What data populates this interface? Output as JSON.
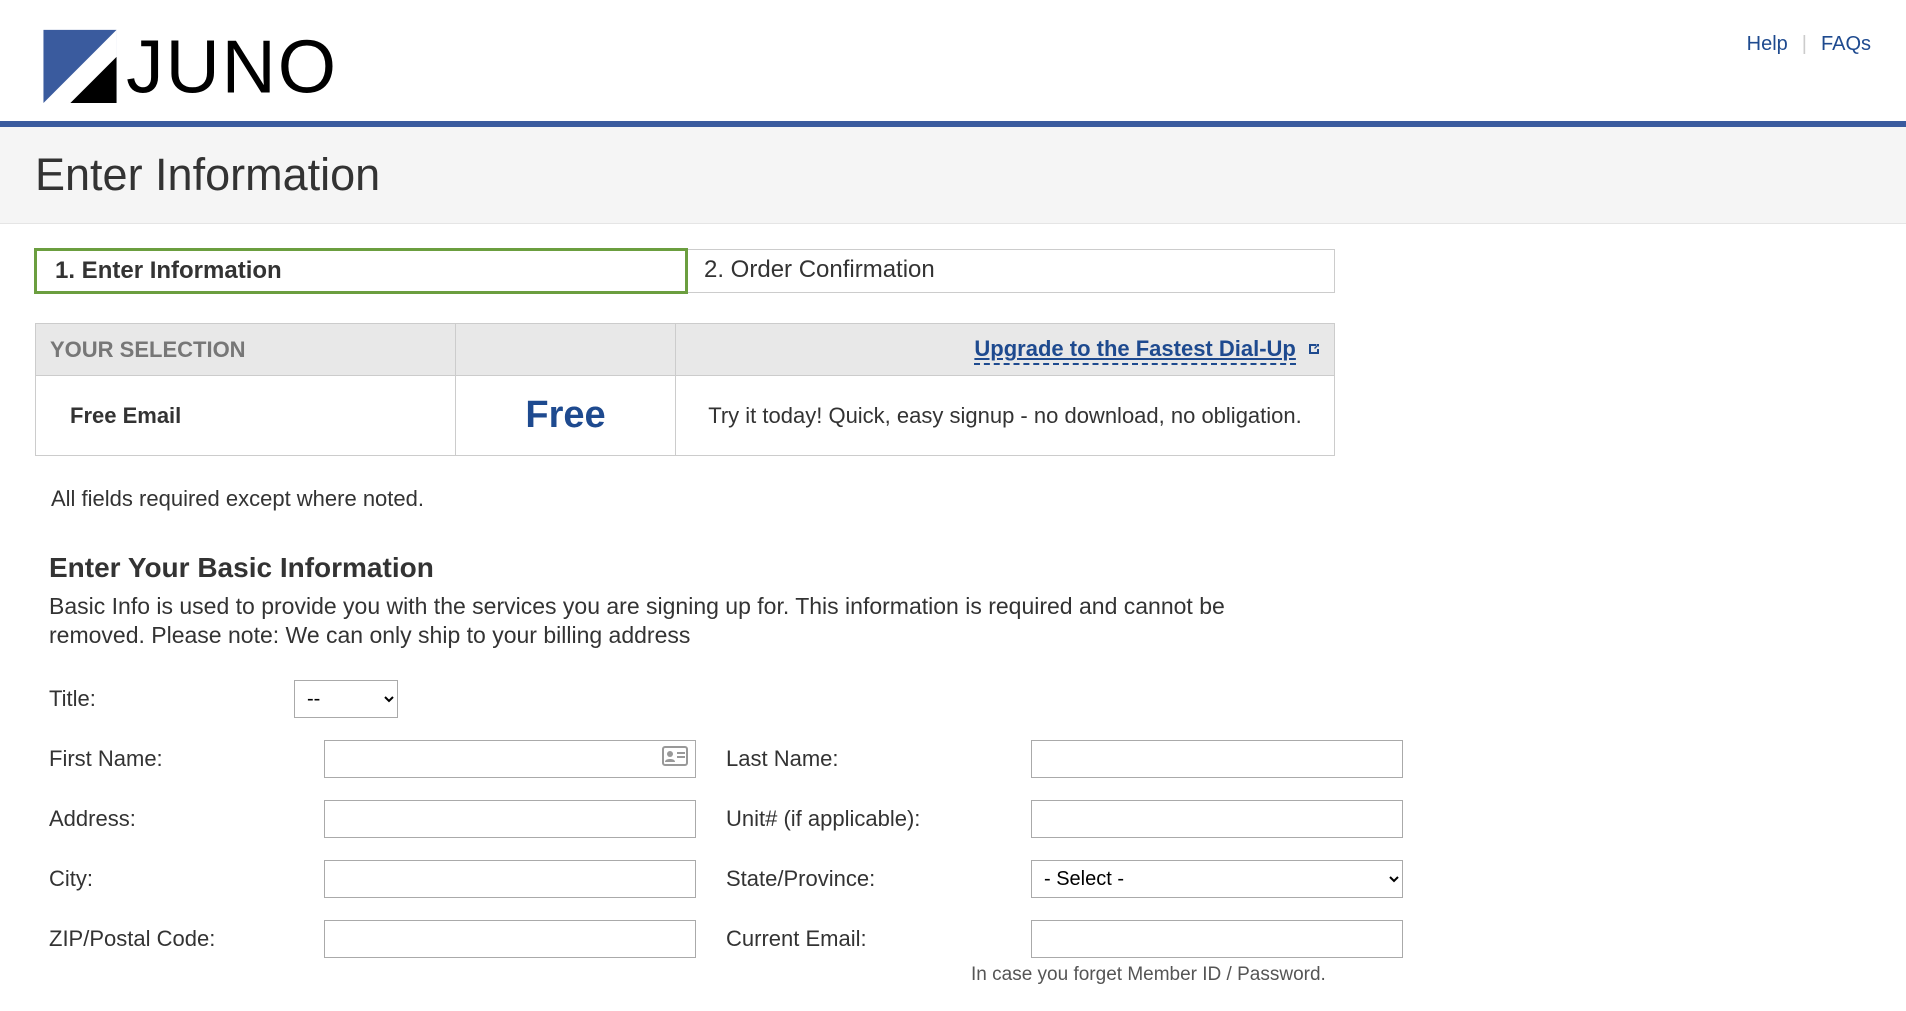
{
  "header": {
    "help_label": "Help",
    "faqs_label": "FAQs"
  },
  "page_title": "Enter Information",
  "steps": [
    {
      "label": "1. Enter Information",
      "active": true
    },
    {
      "label": "2. Order Confirmation",
      "active": false
    }
  ],
  "selection": {
    "header_label": "YOUR SELECTION",
    "upgrade_label": "Upgrade to the Fastest Dial-Up",
    "product": "Free Email",
    "price": "Free",
    "description": "Try it today! Quick, easy signup - no download, no obligation."
  },
  "required_note": "All fields required except where noted.",
  "basic_info": {
    "title": "Enter Your Basic Information",
    "description": "Basic Info is used to provide you with the services you are signing up for. This information is required and cannot be removed. Please note: We can only ship to your billing address",
    "fields": {
      "title_label": "Title:",
      "title_placeholder": "--",
      "first_name_label": "First Name:",
      "last_name_label": "Last Name:",
      "address_label": "Address:",
      "unit_label": "Unit# (if applicable):",
      "city_label": "City:",
      "state_label": "State/Province:",
      "state_placeholder": "- Select -",
      "zip_label": "ZIP/Postal Code:",
      "email_label": "Current Email:",
      "email_hint": "In case you forget Member ID / Password."
    }
  }
}
